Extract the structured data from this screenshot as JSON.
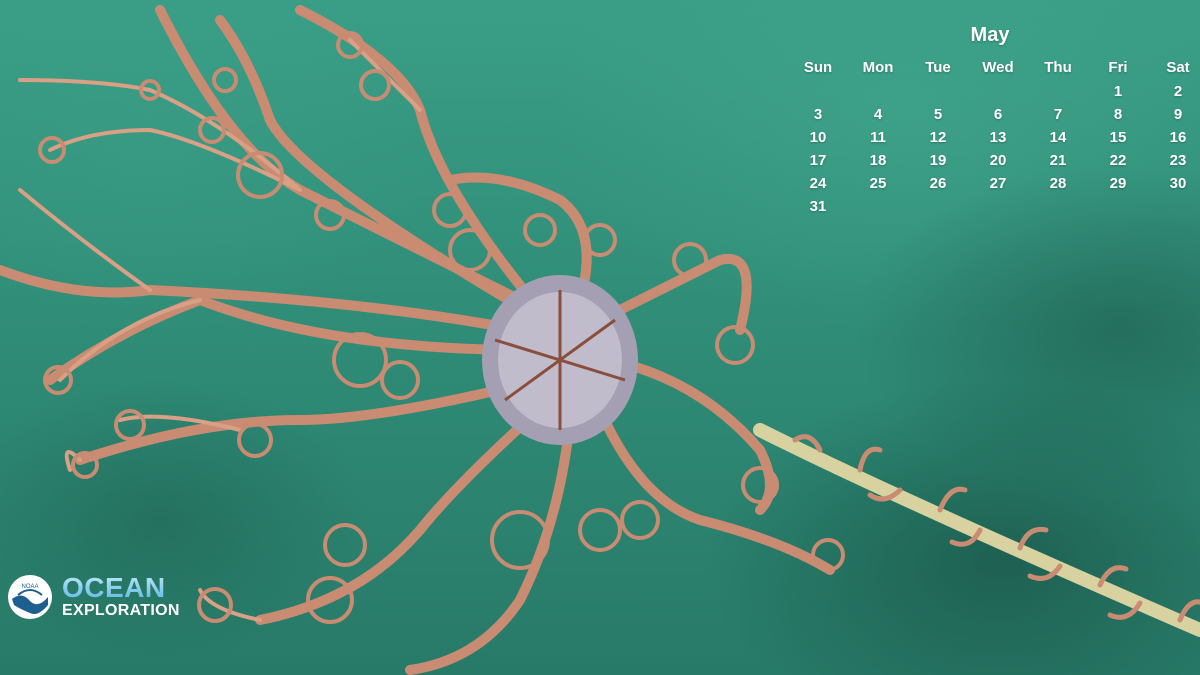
{
  "calendar": {
    "month": "May",
    "weekdays": [
      "Sun",
      "Mon",
      "Tue",
      "Wed",
      "Thu",
      "Fri",
      "Sat"
    ],
    "leading_blank_days": 5,
    "days": [
      "1",
      "2",
      "3",
      "4",
      "5",
      "6",
      "7",
      "8",
      "9",
      "10",
      "11",
      "12",
      "13",
      "14",
      "15",
      "16",
      "17",
      "18",
      "19",
      "20",
      "21",
      "22",
      "23",
      "24",
      "25",
      "26",
      "27",
      "28",
      "29",
      "30",
      "31"
    ]
  },
  "logo": {
    "seal_text": "NOAA",
    "line1": "OCEAN",
    "line2": "EXPLORATION"
  },
  "colors": {
    "water": "#2f8c78",
    "creature": "#c98c72",
    "creature_dark": "#8a4f3c",
    "coral_stalk": "#d8d2a0",
    "text": "#ffffff",
    "logo_blue": "#5ab6e4"
  }
}
